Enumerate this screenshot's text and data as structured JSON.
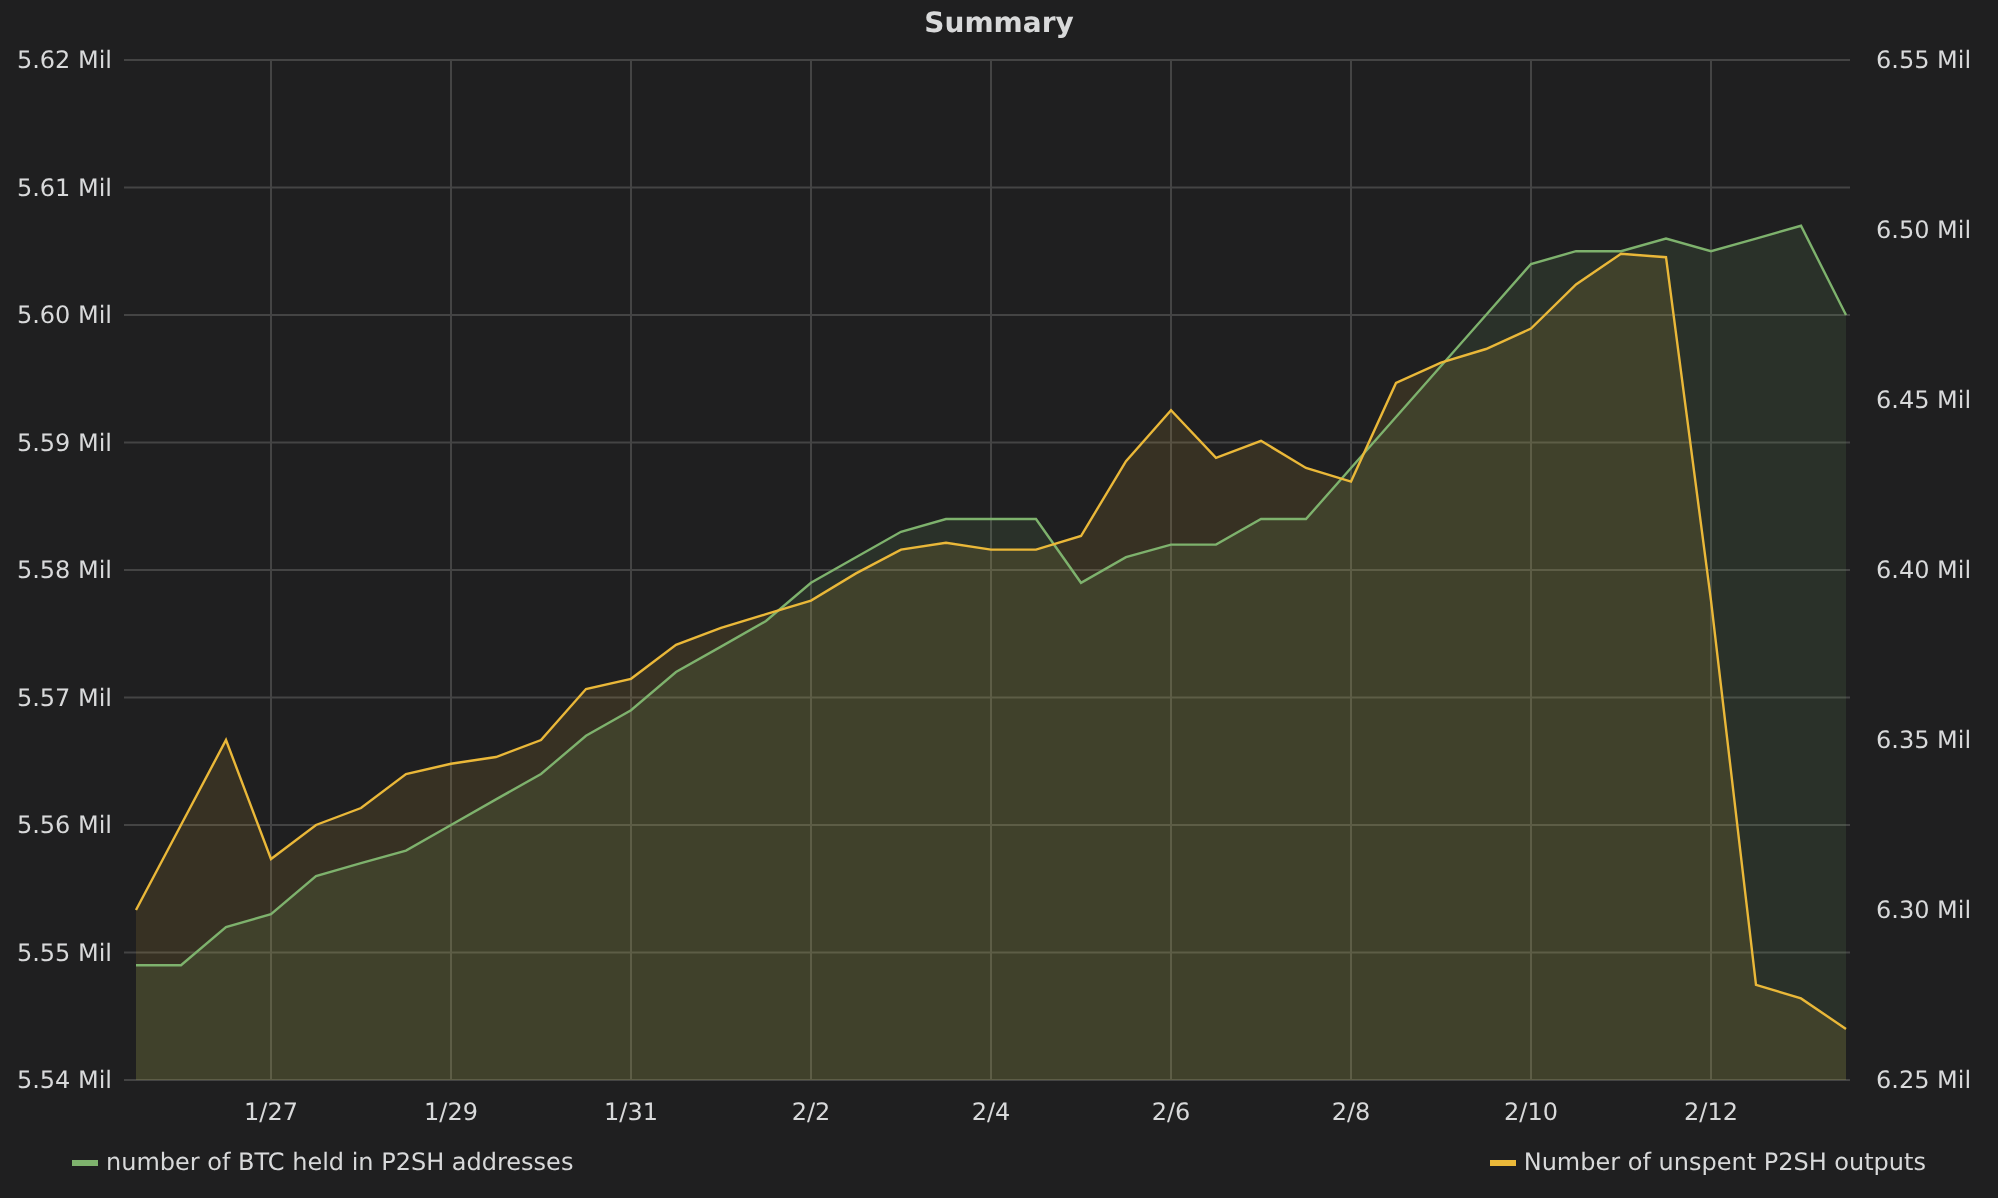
{
  "panel": {
    "title": "Summary",
    "chart_data": {
      "type": "area",
      "grid": true,
      "categories": [
        null,
        null,
        null,
        "1/27",
        null,
        null,
        null,
        "1/29",
        null,
        null,
        null,
        "1/31",
        null,
        null,
        null,
        "2/2",
        null,
        null,
        null,
        "2/4",
        null,
        null,
        null,
        "2/6",
        null,
        null,
        null,
        "2/8",
        null,
        null,
        null,
        "2/10",
        null,
        null,
        null,
        "2/12",
        null,
        null,
        null
      ],
      "ylim": [
        5.54,
        5.62
      ],
      "y2lim": [
        6.25,
        6.55
      ],
      "yticks": [
        {
          "value": 5.62,
          "label": "5.62 Mil"
        },
        {
          "value": 5.61,
          "label": "5.61 Mil"
        },
        {
          "value": 5.6,
          "label": "5.60 Mil"
        },
        {
          "value": 5.59,
          "label": "5.59 Mil"
        },
        {
          "value": 5.58,
          "label": "5.58 Mil"
        },
        {
          "value": 5.57,
          "label": "5.57 Mil"
        },
        {
          "value": 5.56,
          "label": "5.56 Mil"
        },
        {
          "value": 5.55,
          "label": "5.55 Mil"
        },
        {
          "value": 5.54,
          "label": "5.54 Mil"
        }
      ],
      "y2ticks": [
        {
          "value": 6.55,
          "label": "6.55 Mil"
        },
        {
          "value": 6.5,
          "label": "6.50 Mil"
        },
        {
          "value": 6.45,
          "label": "6.45 Mil"
        },
        {
          "value": 6.4,
          "label": "6.40 Mil"
        },
        {
          "value": 6.35,
          "label": "6.35 Mil"
        },
        {
          "value": 6.3,
          "label": "6.30 Mil"
        },
        {
          "value": 6.25,
          "label": "6.25 Mil"
        }
      ],
      "series": [
        {
          "name": "number of BTC held in P2SH addresses",
          "color": "#7eb26d",
          "values": [
            5.549,
            5.549,
            5.552,
            5.553,
            5.556,
            5.557,
            5.558,
            5.56,
            5.562,
            5.564,
            5.567,
            5.569,
            5.572,
            5.574,
            5.576,
            5.579,
            5.581,
            5.583,
            5.584,
            5.584,
            5.584,
            5.579,
            5.581,
            5.582,
            5.582,
            5.584,
            5.584,
            5.588,
            5.592,
            5.596,
            5.6,
            5.604,
            5.605,
            5.605,
            5.606,
            5.605,
            5.606,
            5.607,
            5.6
          ]
        },
        {
          "name": "Number of unspent P2SH outputs",
          "color": "#eab839",
          "axis": "y2",
          "values": [
            6.3,
            6.325,
            6.35,
            6.315,
            6.325,
            6.33,
            6.34,
            6.343,
            6.345,
            6.35,
            6.365,
            6.368,
            6.378,
            6.383,
            6.387,
            6.391,
            6.399,
            6.406,
            6.408,
            6.406,
            6.406,
            6.41,
            6.432,
            6.447,
            6.433,
            6.438,
            6.43,
            6.426,
            6.455,
            6.461,
            6.465,
            6.471,
            6.484,
            6.493,
            6.492,
            6.391,
            6.278,
            6.274,
            6.265
          ]
        }
      ]
    }
  }
}
